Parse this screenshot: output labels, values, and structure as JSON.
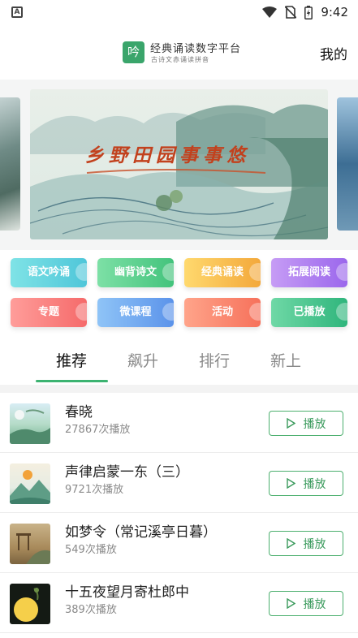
{
  "status_bar": {
    "time": "9:42",
    "notification_label": "A"
  },
  "header": {
    "logo_glyph": "吟",
    "title": "经典诵读数字平台",
    "subtitle": "古诗文赤诵读拼音",
    "mine_label": "我的"
  },
  "banner": {
    "title": "乡野田园事事悠"
  },
  "categories": [
    {
      "label": "语文吟诵",
      "color_from": "#7fe3e6",
      "color_to": "#4fc6d9"
    },
    {
      "label": "幽背诗文",
      "color_from": "#7de0a6",
      "color_to": "#43c37c"
    },
    {
      "label": "经典诵读",
      "color_from": "#ffd96e",
      "color_to": "#f3a83b"
    },
    {
      "label": "拓展阅读",
      "color_from": "#c69cf5",
      "color_to": "#9b67ec"
    },
    {
      "label": "专题",
      "color_from": "#ff9d9a",
      "color_to": "#f56a6a"
    },
    {
      "label": "微课程",
      "color_from": "#8fc4f7",
      "color_to": "#5b93ea"
    },
    {
      "label": "活动",
      "color_from": "#ffa48a",
      "color_to": "#f6715b"
    },
    {
      "label": "已播放",
      "color_from": "#6fd8a6",
      "color_to": "#2fb57c"
    }
  ],
  "tabs": [
    {
      "label": "推荐",
      "active": true
    },
    {
      "label": "飙升",
      "active": false
    },
    {
      "label": "排行",
      "active": false
    },
    {
      "label": "新上",
      "active": false
    }
  ],
  "list": [
    {
      "title": "春晓",
      "plays": "27867次播放",
      "play_label": "播放",
      "thumb_icon": "spring-dawn-thumbnail"
    },
    {
      "title": "声律启蒙一东（三）",
      "plays": "9721次播放",
      "play_label": "播放",
      "thumb_icon": "mountain-sunset-thumbnail"
    },
    {
      "title": "如梦令（常记溪亭日暮）",
      "plays": "549次播放",
      "play_label": "播放",
      "thumb_icon": "pavilion-painting-thumbnail"
    },
    {
      "title": "十五夜望月寄杜郎中",
      "plays": "389次播放",
      "play_label": "播放",
      "thumb_icon": "full-moon-thumbnail"
    }
  ],
  "colors": {
    "accent": "#3cb371",
    "play_border": "#4caf6e",
    "logo_bg": "#3aa56b",
    "banner_title": "#c2411d"
  }
}
